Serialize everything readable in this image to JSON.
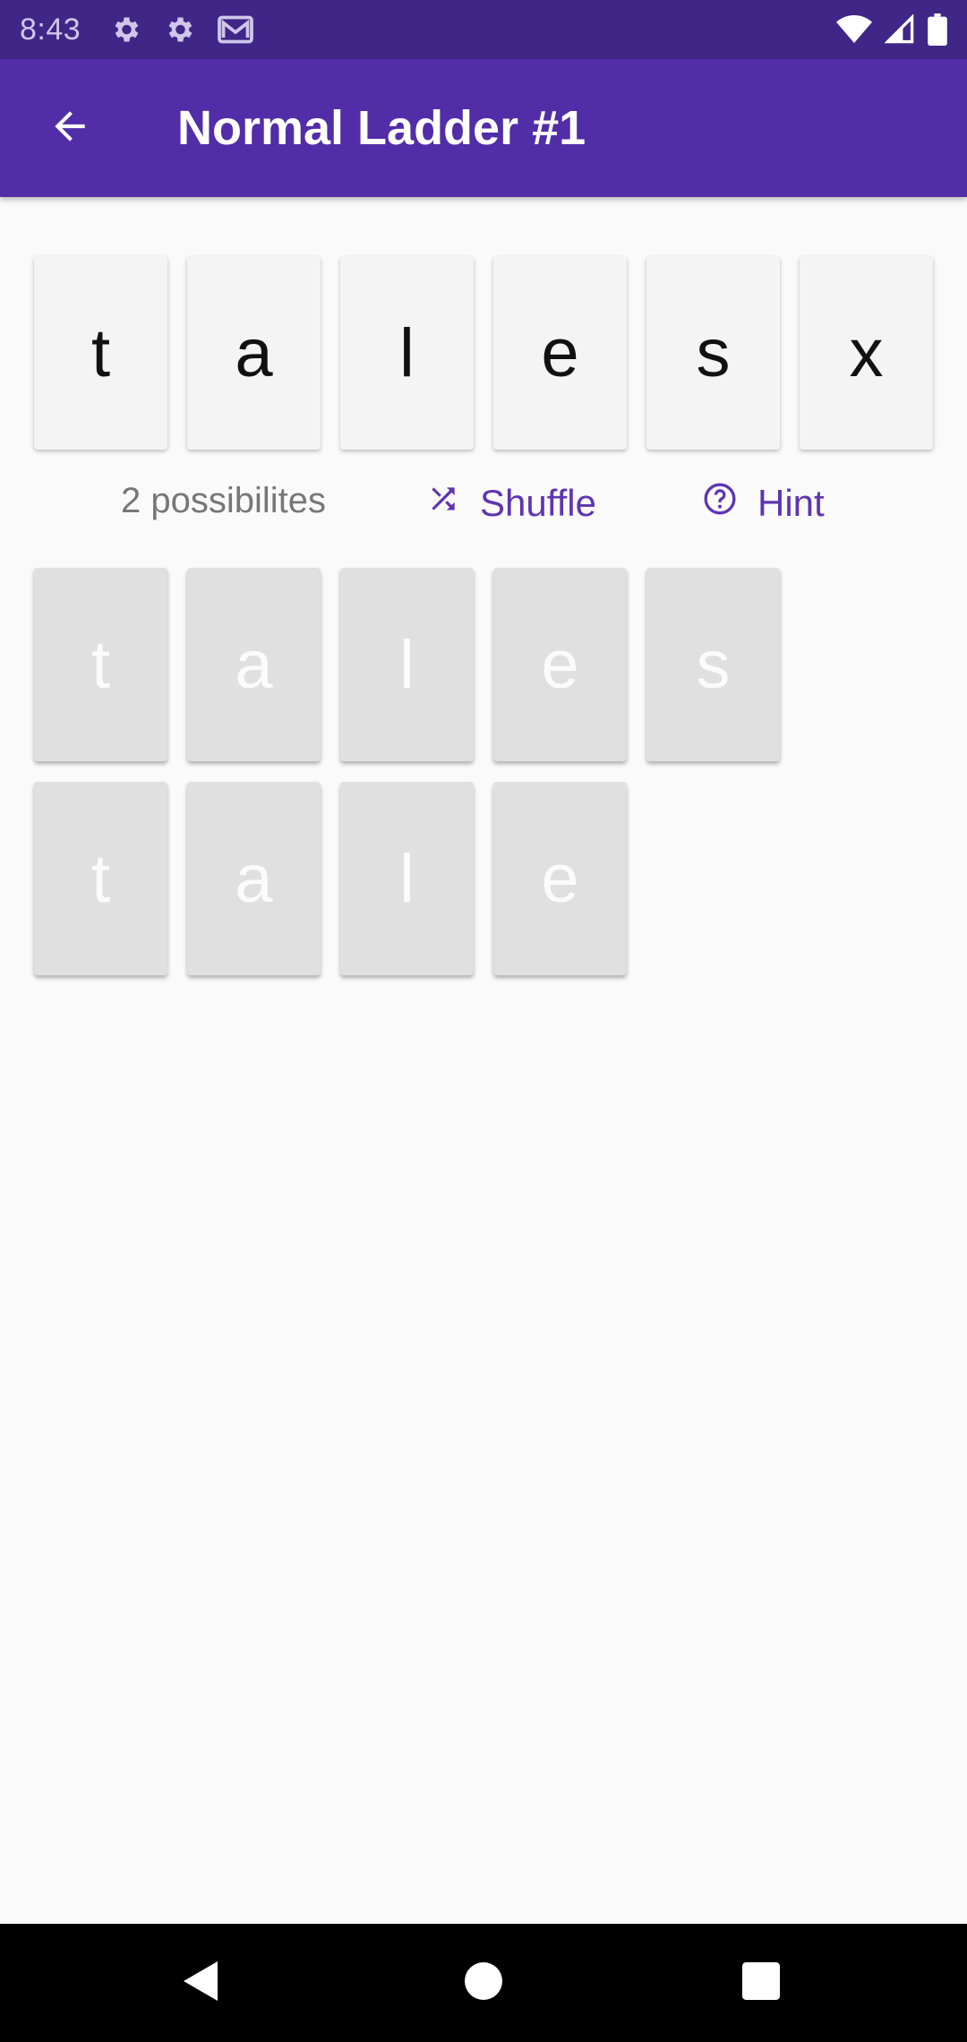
{
  "status_bar": {
    "time": "8:43",
    "left_icons": [
      "settings-icon",
      "settings-icon",
      "gmail-icon"
    ],
    "right_icons": [
      "wifi-icon",
      "signal-icon",
      "battery-icon"
    ]
  },
  "app_bar": {
    "back_icon": "arrow-back-icon",
    "title": "Normal Ladder #1"
  },
  "letter_tiles": [
    "t",
    "a",
    "l",
    "e",
    "s",
    "x"
  ],
  "controls": {
    "possibilities": "2 possibilites",
    "shuffle_label": "Shuffle",
    "shuffle_icon": "shuffle-icon",
    "hint_label": "Hint",
    "hint_icon": "help-circle-icon"
  },
  "answers": [
    [
      "t",
      "a",
      "l",
      "e",
      "s"
    ],
    [
      "t",
      "a",
      "l",
      "e"
    ]
  ],
  "nav_bar": {
    "icons": [
      "nav-back-icon",
      "nav-home-icon",
      "nav-recents-icon"
    ]
  },
  "colors": {
    "status_bar": "#3f2687",
    "app_bar": "#512da8",
    "accent": "#5e35b1",
    "background": "#fafafa"
  }
}
